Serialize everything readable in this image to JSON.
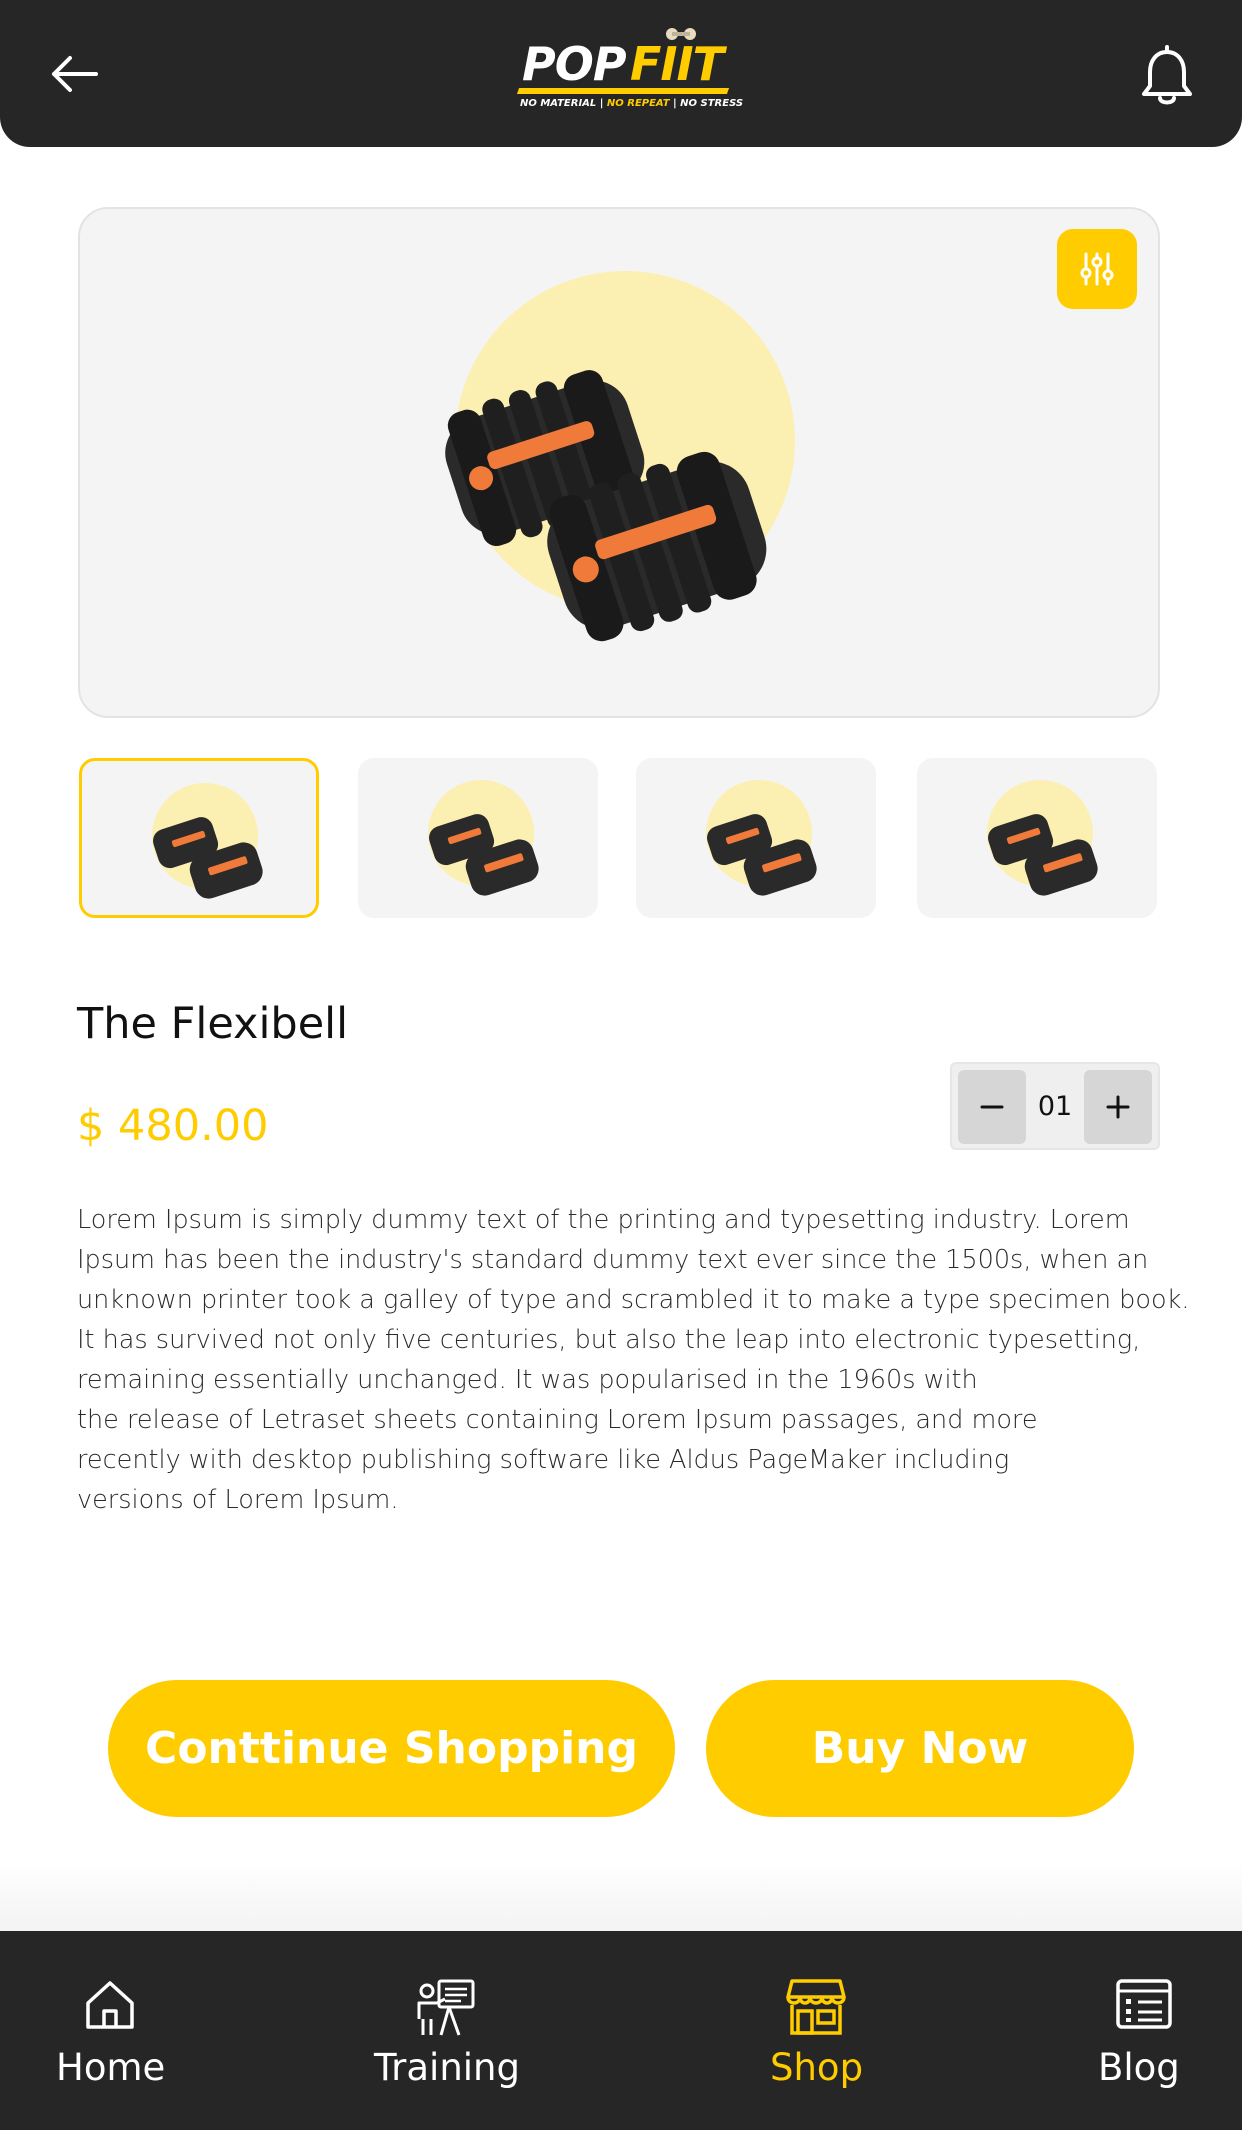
{
  "header": {
    "logo_word_1": "POP",
    "logo_word_2": "FIIT",
    "tagline_1": "NO MATERIAL |",
    "tagline_2": "NO REPEAT",
    "tagline_3": "| NO STRESS",
    "back_icon": "arrow-left-icon",
    "notification_icon": "bell-icon"
  },
  "product": {
    "title": "The Flexibell",
    "price": "$ 480.00",
    "quantity": "01",
    "filter_icon": "sliders-icon",
    "description_lines": [
      "Lorem Ipsum is simply dummy text of the printing and typesetting industry. Lorem",
      "Ipsum has been the industry's standard dummy text ever since the 1500s, when an",
      "unknown printer took a galley of type and scrambled it to make a type specimen book.",
      "It has survived not only five centuries, but also the leap into electronic typesetting,",
      "remaining essentially unchanged. It was popularised in the 1960s with",
      "the release of Letraset sheets containing Lorem Ipsum passages, and more",
      "recently with desktop publishing software like Aldus PageMaker including",
      "versions of Lorem Ipsum."
    ]
  },
  "actions": {
    "continue_label": "Conttinue Shopping",
    "buy_label": "Buy Now"
  },
  "nav": {
    "items": [
      {
        "label": "Home",
        "icon": "home-icon",
        "active": false
      },
      {
        "label": "Training",
        "icon": "training-icon",
        "active": false
      },
      {
        "label": "Shop",
        "icon": "shop-icon",
        "active": true
      },
      {
        "label": "Blog",
        "icon": "blog-icon",
        "active": false
      }
    ]
  },
  "colors": {
    "accent": "#ffcc00",
    "dark": "#262626",
    "hero_bg": "#f4f4f4"
  }
}
